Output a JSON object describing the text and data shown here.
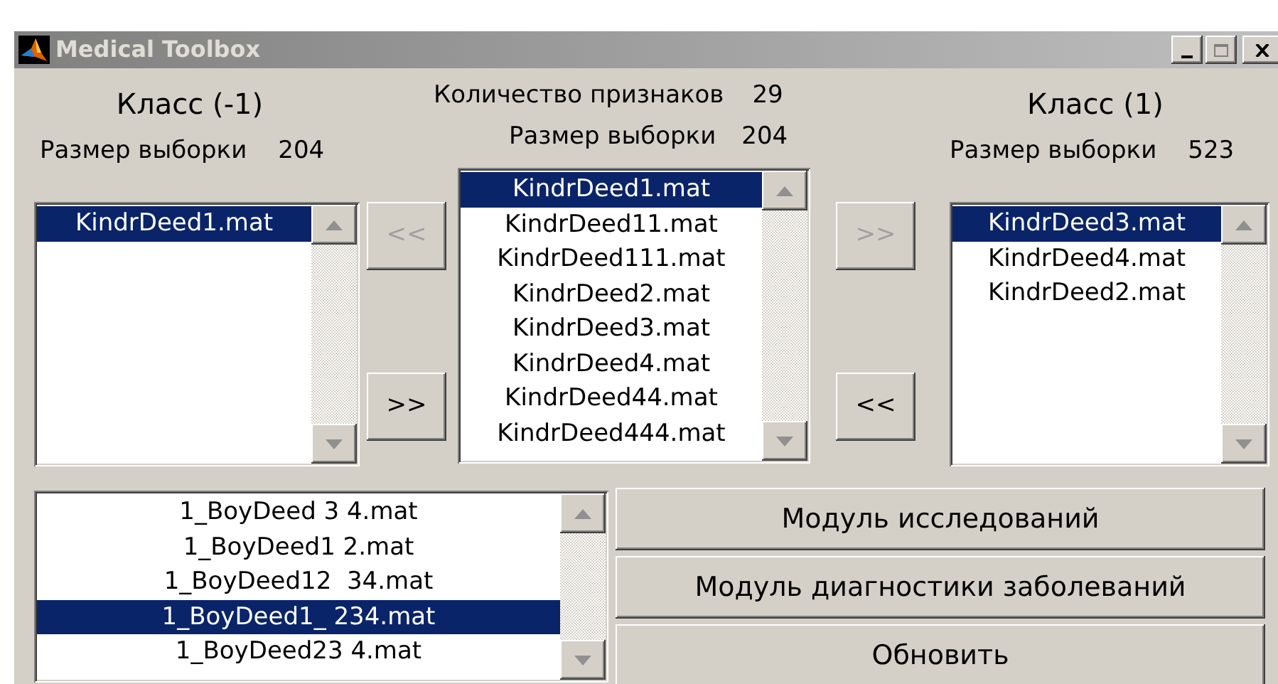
{
  "window": {
    "title": "Medical Toolbox"
  },
  "class_neg": {
    "title": "Класс (-1)",
    "sample_label": "Размер выборки",
    "sample_value": "204",
    "files": [
      {
        "name": "KindrDeed1.mat",
        "selected": true
      }
    ]
  },
  "center": {
    "features_label": "Количество признаков",
    "features_value": "29",
    "sample_label": "Размер выборки",
    "sample_value": "204",
    "files": [
      {
        "name": "KindrDeed1.mat",
        "selected": true
      },
      {
        "name": "KindrDeed11.mat",
        "selected": false
      },
      {
        "name": "KindrDeed111.mat",
        "selected": false
      },
      {
        "name": "KindrDeed2.mat",
        "selected": false
      },
      {
        "name": "KindrDeed3.mat",
        "selected": false
      },
      {
        "name": "KindrDeed4.mat",
        "selected": false
      },
      {
        "name": "KindrDeed44.mat",
        "selected": false
      },
      {
        "name": "KindrDeed444.mat",
        "selected": false
      }
    ]
  },
  "class_pos": {
    "title": "Класс (1)",
    "sample_label": "Размер выборки",
    "sample_value": "523",
    "files": [
      {
        "name": "KindrDeed3.mat",
        "selected": true
      },
      {
        "name": "KindrDeed4.mat",
        "selected": false
      },
      {
        "name": "KindrDeed2.mat",
        "selected": false
      }
    ]
  },
  "transfer_buttons": [
    {
      "label": "<<",
      "disabled": true
    },
    {
      "label": ">>",
      "disabled": false
    },
    {
      "label": ">>",
      "disabled": true
    },
    {
      "label": "<<",
      "disabled": false
    }
  ],
  "bottom_list": {
    "files": [
      {
        "name": "1_BoyDeed 3 4.mat",
        "selected": false
      },
      {
        "name": "1_BoyDeed1 2.mat",
        "selected": false
      },
      {
        "name": "1_BoyDeed12  34.mat",
        "selected": false
      },
      {
        "name": "1_BoyDeed1_ 234.mat",
        "selected": true
      },
      {
        "name": "1_BoyDeed23 4.mat",
        "selected": false
      }
    ]
  },
  "actions": [
    {
      "label": "Модуль исследований"
    },
    {
      "label": "Модуль диагностики заболеваний"
    },
    {
      "label": "Обновить"
    }
  ]
}
